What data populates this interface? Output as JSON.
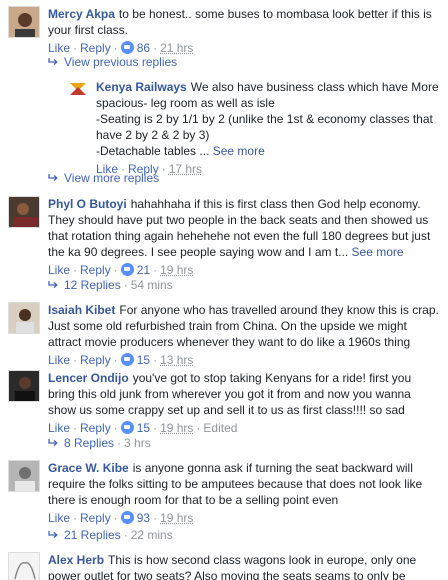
{
  "comments": [
    {
      "author": "Mercy Akpa",
      "text": "to be honest.. some buses to mombasa look better if this is your first class.",
      "like": "Like",
      "reply": "Reply",
      "reactions": "86",
      "time": "21 hrs"
    },
    {
      "author": "Phyl O Butoyi",
      "text": "hahahhaha if this is first class then God help economy. They should have put two people in the back seats and then showed us that rotation thing again hehehehe not even the full 180 degrees but just the ka 90 degrees. I see people saying wow and I am t...",
      "see_more": "See more",
      "like": "Like",
      "reply": "Reply",
      "reactions": "21",
      "time": "19 hrs",
      "replies": "12 Replies",
      "replies_time": "54 mins"
    },
    {
      "author": "Isaiah Kibet",
      "text": "For anyone who has travelled around they know this is crap. Just some old refurbished train from China. On the upside we might attract movie producers whenever they want to do like a 1960s thing",
      "like": "Like",
      "reply": "Reply",
      "reactions": "15",
      "time": "13 hrs"
    },
    {
      "author": "Lencer Ondijo",
      "text": "you've got to stop taking Kenyans for a ride! first you bring this old junk from wherever you got it from and now you wanna show us some crappy set up and sell it to us as first class!!!! so sad",
      "like": "Like",
      "reply": "Reply",
      "reactions": "15",
      "time": "19 hrs",
      "edited": "Edited",
      "replies": "8 Replies",
      "replies_time": "3 hrs"
    },
    {
      "author": "Grace W. Kibe",
      "text": "is anyone gonna ask if turning the seat backward will require the folks sitting to be amputees because that does not look like there is enough room for that to be a selling point even",
      "like": "Like",
      "reply": "Reply",
      "reactions": "93",
      "time": "19 hrs",
      "replies": "21 Replies",
      "replies_time": "22 mins"
    },
    {
      "author": "Alex Herb",
      "text": "This is how second class wagons look in europe, only one power outlet for two seats? Also moving the seats seams to only be possibe when no"
    }
  ],
  "view_previous": "View previous replies",
  "view_more": "View more replies",
  "reply": {
    "author": "Kenya Railways",
    "text": "We also have business class which have More spacious- leg room as well as isle",
    "line2": "-Seating is 2 by 1/1 by 2 (unlike the 1st & economy classes that have 2 by 2 & 2 by 3)",
    "line3": "-Detachable tables ...",
    "see_more": "See more",
    "like": "Like",
    "reply": "Reply",
    "time": "17 hrs"
  },
  "colors": {
    "link": "#365899",
    "action": "#4267b2",
    "muted": "#90949c",
    "reaction": "#5890ff"
  }
}
